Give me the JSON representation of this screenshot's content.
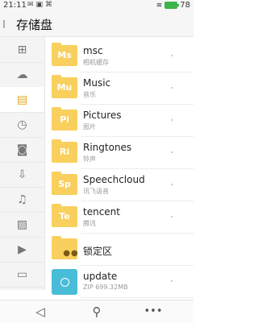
{
  "status_bar": {
    "time": "21:11",
    "battery_level": "78",
    "battery_color": "#3bb54a"
  },
  "header": {
    "title": "存储盘"
  },
  "sidebar": {
    "items": [
      {
        "icon": "category-icon",
        "glyph": "⊞"
      },
      {
        "icon": "cloud-icon",
        "glyph": "☁"
      },
      {
        "icon": "storage-icon",
        "glyph": "▤",
        "active": true
      },
      {
        "icon": "recent-icon",
        "glyph": "◷"
      },
      {
        "icon": "camera-icon",
        "glyph": "◙"
      },
      {
        "icon": "download-icon",
        "glyph": "⇩"
      },
      {
        "icon": "music-icon",
        "glyph": "♫"
      },
      {
        "icon": "image-icon",
        "glyph": "▨"
      },
      {
        "icon": "video-icon",
        "glyph": "▶"
      },
      {
        "icon": "document-icon",
        "glyph": "▭"
      }
    ]
  },
  "files": [
    {
      "abbr": "Ms",
      "name": "msc",
      "subtitle": "相机缓存",
      "type": "folder"
    },
    {
      "abbr": "Mu",
      "name": "Music",
      "subtitle": "音乐",
      "type": "folder"
    },
    {
      "abbr": "Pi",
      "name": "Pictures",
      "subtitle": "图片",
      "type": "folder"
    },
    {
      "abbr": "Ri",
      "name": "Ringtones",
      "subtitle": "铃声",
      "type": "folder"
    },
    {
      "abbr": "Sp",
      "name": "Speechcloud",
      "subtitle": "讯飞语音",
      "type": "folder"
    },
    {
      "abbr": "Te",
      "name": "tencent",
      "subtitle": "腾讯",
      "type": "folder"
    },
    {
      "abbr": "",
      "name": "锁定区",
      "subtitle": "",
      "type": "locked-folder"
    },
    {
      "abbr": "",
      "name": "update",
      "subtitle": "ZIP 699.32MB",
      "type": "zip"
    }
  ],
  "accent_color": "#f9cf5d",
  "bottom_bar": {
    "back_icon": "back-icon",
    "search_icon": "search-icon",
    "more_icon": "more-icon"
  }
}
